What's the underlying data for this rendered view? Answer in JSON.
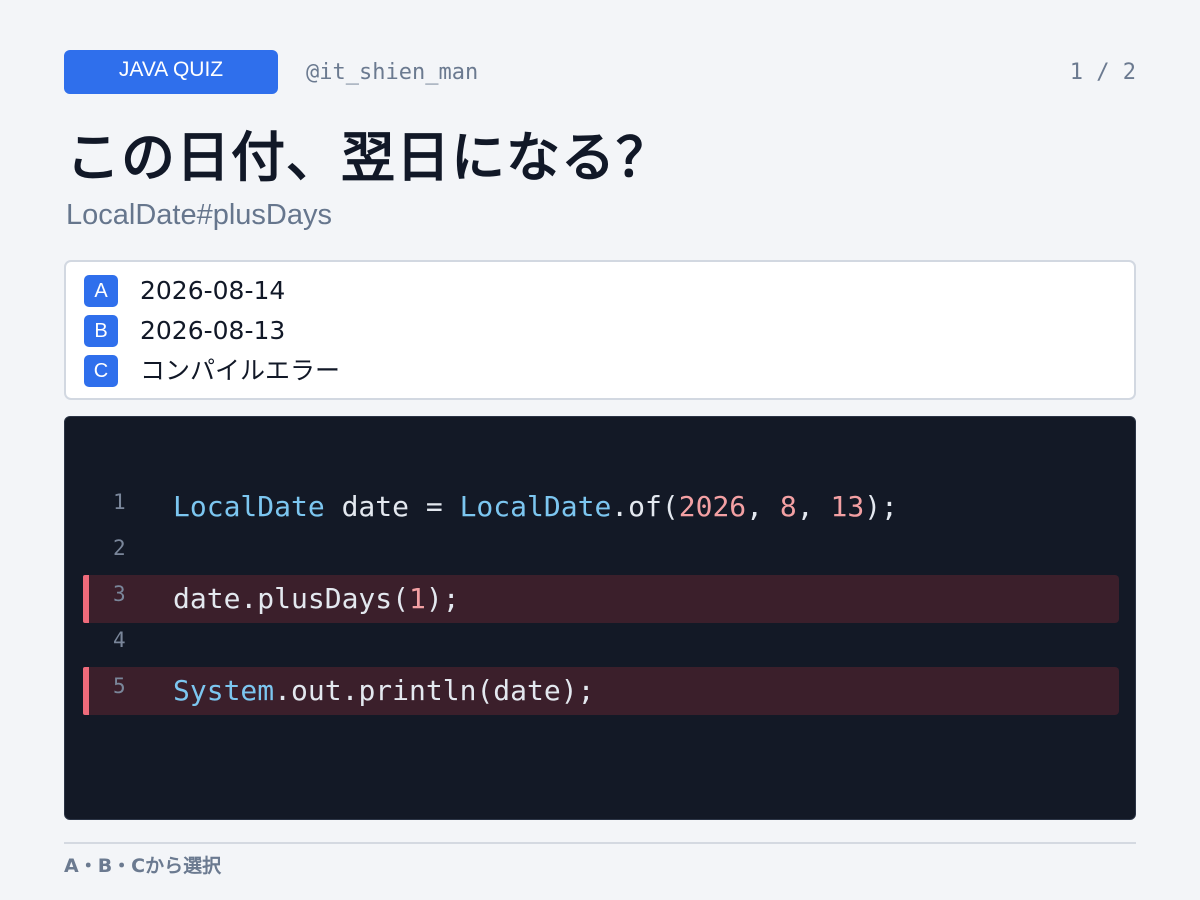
{
  "header": {
    "badge": "JAVA QUIZ",
    "handle": "@it_shien_man",
    "pager": "1 / 2"
  },
  "title": "この日付、翌日になる？",
  "subtitle": "LocalDate#plusDays",
  "options": [
    {
      "key": "A",
      "text": "2026-08-14"
    },
    {
      "key": "B",
      "text": "2026-08-13"
    },
    {
      "key": "C",
      "text": "コンパイルエラー"
    }
  ],
  "code": {
    "lines": [
      {
        "number": "1",
        "highlighted": false,
        "tokens": [
          {
            "text": "LocalDate",
            "kind": "type"
          },
          {
            "text": " date = ",
            "kind": "plain"
          },
          {
            "text": "LocalDate",
            "kind": "type"
          },
          {
            "text": ".of(",
            "kind": "plain"
          },
          {
            "text": "2026",
            "kind": "num"
          },
          {
            "text": ", ",
            "kind": "plain"
          },
          {
            "text": "8",
            "kind": "num"
          },
          {
            "text": ", ",
            "kind": "plain"
          },
          {
            "text": "13",
            "kind": "num"
          },
          {
            "text": ");",
            "kind": "plain"
          }
        ]
      },
      {
        "number": "2",
        "highlighted": false,
        "tokens": []
      },
      {
        "number": "3",
        "highlighted": true,
        "tokens": [
          {
            "text": "date.plusDays(",
            "kind": "plain"
          },
          {
            "text": "1",
            "kind": "num"
          },
          {
            "text": ");",
            "kind": "plain"
          }
        ]
      },
      {
        "number": "4",
        "highlighted": false,
        "tokens": []
      },
      {
        "number": "5",
        "highlighted": true,
        "tokens": [
          {
            "text": "System",
            "kind": "type"
          },
          {
            "text": ".out.println(date);",
            "kind": "plain"
          }
        ]
      }
    ]
  },
  "footer": "A・B・Cから選択",
  "colors": {
    "accent": "#2f6fec",
    "code_background": "#131926",
    "highlight_bar": "#ef6b7b",
    "type_token": "#7cc6f0",
    "number_token": "#f3a0a3"
  }
}
